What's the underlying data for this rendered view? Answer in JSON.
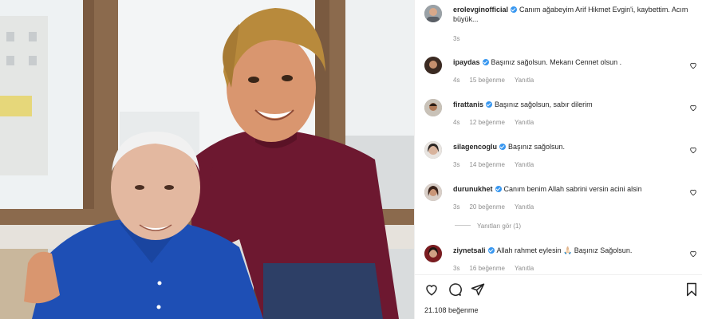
{
  "post": {
    "author": "erolevginofficial",
    "caption": "Canım ağabeyim Arif Hikmet Evgin'i, kaybettim. Acım büyük...",
    "time": "3s"
  },
  "reply_label": "Yanıtla",
  "comments": [
    {
      "user": "ipaydas",
      "text": "Başınız sağolsun. Mekanı Cennet olsun .",
      "time": "4s",
      "likes": "15 beğenme"
    },
    {
      "user": "firattanis",
      "text": "Başınız sağolsun, sabır dilerim",
      "time": "4s",
      "likes": "12 beğenme"
    },
    {
      "user": "silagencoglu",
      "text": "Başınız sağolsun.",
      "time": "3s",
      "likes": "14 beğenme"
    },
    {
      "user": "durunukhet",
      "text": "Canım benim Allah sabrini versin acini alsin",
      "time": "3s",
      "likes": "20 beğenme"
    },
    {
      "user": "ziynetsali",
      "text": "Allah rahmet eylesin 🙏🏻 Başınız Sağolsun.",
      "time": "3s",
      "likes": "16 beğenme"
    }
  ],
  "view_replies": "Yanıtları gör (1)",
  "likes_total": "21.108 beğenme",
  "icons": {
    "like": "heart-icon",
    "comment": "comment-icon",
    "share": "share-icon",
    "save": "bookmark-icon"
  },
  "colors": {
    "verified": "#3897f0",
    "muted": "#8e8e8e",
    "text": "#262626"
  }
}
